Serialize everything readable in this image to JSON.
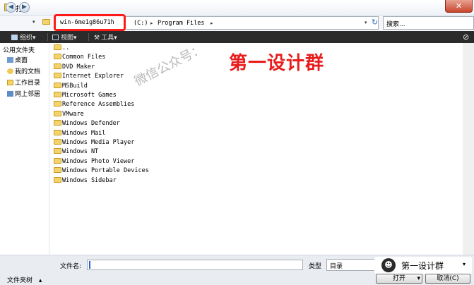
{
  "window": {
    "title": "打开",
    "close_label": "✕"
  },
  "address": {
    "back_label": "◀",
    "forward_label": "▶",
    "dropdown_label": "▾",
    "computer": "win-6me1g86u71h",
    "drive": "(C:)",
    "folder": "Program Files",
    "sep": "▸",
    "refresh_label": "↻",
    "search_placeholder": "搜索..."
  },
  "toolbar": {
    "organize": "组织",
    "views": "视图",
    "tools": "工具",
    "arrow": "▾"
  },
  "sidebar": {
    "items": [
      {
        "label": "公用文件夹",
        "icon": "none"
      },
      {
        "label": "桌面",
        "icon": "desktop-icon"
      },
      {
        "label": "我的文档",
        "icon": "documents-icon"
      },
      {
        "label": "工作目录",
        "icon": "folder-icon"
      },
      {
        "label": "网上邻居",
        "icon": "network-icon"
      }
    ]
  },
  "files": [
    {
      "name": ".."
    },
    {
      "name": "Common Files"
    },
    {
      "name": "DVD Maker"
    },
    {
      "name": "Internet Explorer"
    },
    {
      "name": "MSBuild"
    },
    {
      "name": "Microsoft Games"
    },
    {
      "name": "Reference Assemblies"
    },
    {
      "name": "VMware"
    },
    {
      "name": "Windows Defender"
    },
    {
      "name": "Windows Mail"
    },
    {
      "name": "Windows Media Player"
    },
    {
      "name": "Windows NT"
    },
    {
      "name": "Windows Photo Viewer"
    },
    {
      "name": "Windows Portable Devices"
    },
    {
      "name": "Windows Sidebar"
    }
  ],
  "overlay": {
    "title": "第一设计群",
    "watermark": "微信公众号："
  },
  "bottom": {
    "filename_label": "文件名:",
    "filename_value": "",
    "type_label": "类型",
    "type_value": "目录",
    "folder_tree": "文件夹树",
    "folder_tree_arrow": "▴",
    "open_button": "打开",
    "open_dropdown": "▾",
    "cancel_button": "取消(C)",
    "wechat_badge": "第一设计群"
  },
  "colors": {
    "highlight": "#ff1a1a",
    "toolbar": "#2b2b2b",
    "overlay_text": "#e81c1c"
  }
}
